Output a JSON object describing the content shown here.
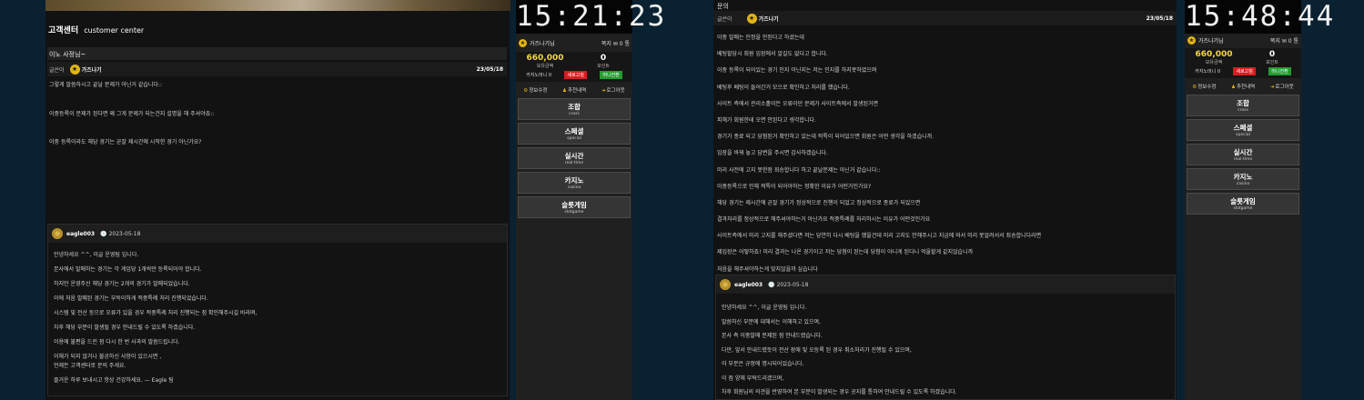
{
  "left": {
    "header_title": "고객센터",
    "header_sub": "customer center",
    "post_title": "이노 사정님~",
    "meta": {
      "writer_label": "글쓴이",
      "level_icon": "★",
      "author": "가즈나기",
      "date": "23/05/18"
    },
    "question_lines": [
      "그렇게 말씀하시고 끝날 문제가 아닌거 같습니다::",
      "",
      "이중등록이 문제가 된다면 왜 그게 문제가 되는건지 설명을 해 주셔야죠::",
      "",
      "이중 등록이라도 해당 경기는 곧잘 제시간에 시작한 경기 아닌가요?"
    ],
    "reply": {
      "author": "eagle003",
      "clock_icon": "🕓",
      "date": "2023-05-18",
      "lines": [
        "안녕하세요 ^^, 이글 운영팀 입니다.",
        "본사에서 발매하는 경기는 각 게임당 1개씩만 등록되어야 합니다.",
        "하지만 운영주신 해당 경기는 2개의 경기가 발매되었습니다.",
        "이에 처음 발매된 경기는 부득이하게 적중특례 처리 진행되었습니다.",
        "시스템 및 전산 등으로 오류가 있을 경우 적중특례 처리 진행되는 점 확인해주시길 바라며,",
        "차후 해당 부분이 발생될 경우 안내드릴 수 있도록 하겠습니다.",
        "이용에 불편을 드린 점 다시 한 번 사과의 말씀드립니다.",
        "이해가 되지 않거나 불공하신 사항이 있으시면 ,",
        "언제든 고객센터로 문의 주세요.",
        "즐거운 하루 보내시고 항상 건강하세요. — Eagle 팀"
      ]
    }
  },
  "sidebar_left": {
    "clock": "15:21:23",
    "user": "가즈나기님",
    "note_label": "쪽지",
    "note_count": "0 통",
    "money": "660,000",
    "money_label": "보유금액",
    "point": "0",
    "point_label": "포인트",
    "casino_label": "카지노머니 0",
    "refresh_btn": "새로고침",
    "mini_btn": "머니전환",
    "links": [
      "정보수정",
      "추천내역",
      "로그아웃"
    ],
    "menu": [
      {
        "k": "조합",
        "e": "cross"
      },
      {
        "k": "스페셜",
        "e": "special"
      },
      {
        "k": "실시간",
        "e": "real-time"
      },
      {
        "k": "카지노",
        "e": "casino"
      },
      {
        "k": "슬롯게임",
        "e": "slotgame"
      }
    ]
  },
  "right": {
    "title": "문의",
    "meta": {
      "writer_label": "글쓴이",
      "level_icon": "★",
      "author": "가즈나기",
      "date": "23/05/18"
    },
    "lines": [
      "이중 발매는 인정을 안된다고 하셨는데",
      "베팅할당시 회원 입장에서 알길도 없다고 합니다.",
      "이중 등록이 되어있는 경기 인지 아닌지는 저는 인지를 하지못하였으며",
      "베팅후 베팅이 들어간거 모으로 확인하고 처리를 했습니다.",
      "사이트 측에서 관리소홀이든 오류이던 문제가 사이트측에서 발생된거면",
      "피해가 회원한테 오면 안된다고 생각합니다.",
      "경기가 종료 되고 당첨된거 확인하고 있는데 적특이 되어있으면 회원은 어떤 생각을 하겠습니까.",
      "입장을 바꿔 놓고 답변을 주시면 감사하겠습니다.",
      "미리 사전에 고지 못한점 죄송합니다 하고 끝날문제는 아닌거 같습니다::",
      "이중등록으로 인해 적특이 되어야하는 정확한 이유가 어떤거인가요?",
      "해당 경기는 제시간에 곧잘 경기가 정상적으로 진행이 되었고 정상적으로 종료가 되었으면",
      "결과처리를 정상적으로 해주셔야하는거 아닌가요 적중특례를 처리하시는 이유가 어떤것인가요",
      "사이트측에서 미리 고지를 해주셨다면 저는 당연히 다시 베팅을 했을건데 미리 고지도 안해주시고 지금에 와서 미리 못알려서서 죄송합니다라면",
      "제입장은 어떻하죠! 미리 결과는 나온 경기이고 저는 당첨이 된는데 당첨이 아니게 된다니 억울할게 같지않습니까",
      "처음을 해주셔야하는게 맞지않을까 싶습니다"
    ],
    "reply": {
      "author": "eagle003",
      "clock_icon": "🕓",
      "date": "2023-05-18",
      "lines": [
        "안녕하세요 ^^, 이글 운영팀 입니다.",
        "말씀하신 부분에 대해서는 이해하고 있으며,",
        "본사 측 이중발매 문제된 점 안내드렸습니다.",
        "다만, 앞서 안내드렸듯이 전산 장애 및 오등록 된 경우 취소처리가 진행될 수 있으며,",
        "이 부분은 규정에 명시되어있습니다.",
        "이 점 양해 부탁드리겠으며,",
        "차후 회원님의 의견을 반영하여 본 부분이 발생되는 경우 공지를 통하여 안내드릴 수 있도록 하겠습니다."
      ]
    }
  },
  "sidebar_right": {
    "clock": "15:48:44",
    "user": "가즈나기님",
    "note_label": "쪽지",
    "note_count": "0 통",
    "money": "660,000",
    "money_label": "보유금액",
    "point": "0",
    "point_label": "포인트",
    "casino_label": "카지노머니 0",
    "refresh_btn": "새로고침",
    "mini_btn": "머니전환",
    "links": [
      "정보수정",
      "추천내역",
      "로그아웃"
    ],
    "menu": [
      {
        "k": "조합",
        "e": "cross"
      },
      {
        "k": "스페셜",
        "e": "special"
      },
      {
        "k": "실시간",
        "e": "real-time"
      },
      {
        "k": "카지노",
        "e": "casino"
      },
      {
        "k": "슬롯게임",
        "e": "slotgame"
      }
    ]
  },
  "colors": {
    "gold": "#f3d73c",
    "bg": "#0a2132",
    "panel": "#121212",
    "red": "#d21f1f",
    "green": "#249c31"
  }
}
